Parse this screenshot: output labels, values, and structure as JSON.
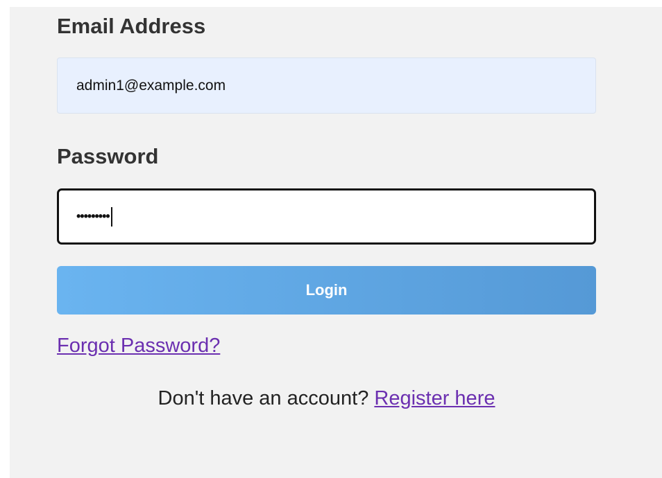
{
  "form": {
    "email": {
      "label": "Email Address",
      "value": "admin1@example.com"
    },
    "password": {
      "label": "Password",
      "masked_value": "•••••••••"
    },
    "login_label": "Login",
    "forgot_label": "Forgot Password?",
    "register_prompt": "Don't have an account?",
    "register_link": "Register here"
  },
  "colors": {
    "card_background": "#f2f2f2",
    "email_field_background": "#e8f0fe",
    "login_gradient_start": "#6ab4f0",
    "login_gradient_end": "#5599d6",
    "link": "#6b2fb0"
  }
}
